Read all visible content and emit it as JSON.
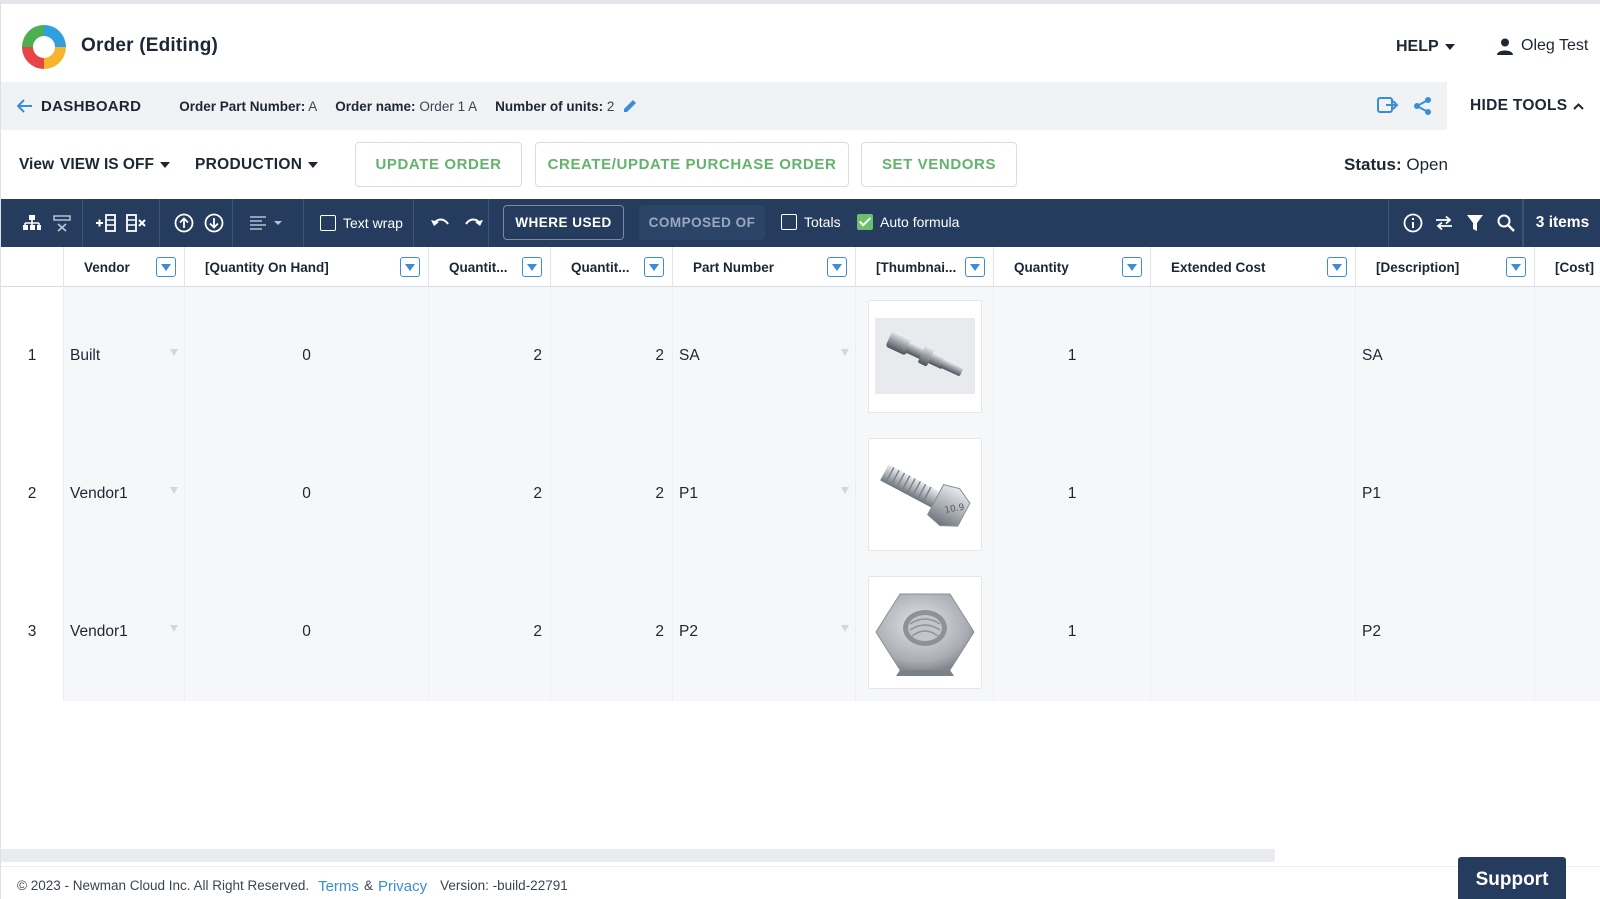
{
  "header": {
    "title": "Order (Editing)",
    "help_label": "HELP",
    "user_name": "Oleg Test"
  },
  "infobar": {
    "back_label": "DASHBOARD",
    "part_number_label": "Order Part Number:",
    "part_number_value": "A",
    "order_name_label": "Order name:",
    "order_name_value": "Order 1 A",
    "units_label": "Number of units:",
    "units_value": "2",
    "hide_tools_label": "HIDE TOOLS"
  },
  "actions": {
    "view_label": "View",
    "view_value": "VIEW IS OFF",
    "production_label": "PRODUCTION",
    "update_order": "UPDATE ORDER",
    "create_po": "CREATE/UPDATE PURCHASE ORDER",
    "set_vendors": "SET VENDORS",
    "status_label": "Status:",
    "status_value": "Open"
  },
  "toolbar": {
    "text_wrap": "Text wrap",
    "where_used": "WHERE USED",
    "composed_of": "COMPOSED OF",
    "totals": "Totals",
    "auto_formula": "Auto formula",
    "text_wrap_checked": false,
    "totals_checked": false,
    "auto_formula_checked": true,
    "items_count": "3 items"
  },
  "table": {
    "columns": [
      "Vendor",
      "[Quantity On Hand]",
      "Quantit...",
      "Quantit...",
      "Part Number",
      "[Thumbnai...",
      "Quantity",
      "Extended Cost",
      "[Description]",
      "[Cost]"
    ],
    "rows": [
      {
        "index": "1",
        "vendor": "Built",
        "qoh": "0",
        "q1": "2",
        "q2": "2",
        "part": "SA",
        "thumb": "shaft-thumbnail",
        "qty": "1",
        "ext_cost": "",
        "desc": "SA",
        "cost": ""
      },
      {
        "index": "2",
        "vendor": "Vendor1",
        "qoh": "0",
        "q1": "2",
        "q2": "2",
        "part": "P1",
        "thumb": "bolt-thumbnail",
        "qty": "1",
        "ext_cost": "",
        "desc": "P1",
        "cost": ""
      },
      {
        "index": "3",
        "vendor": "Vendor1",
        "qoh": "0",
        "q1": "2",
        "q2": "2",
        "part": "P2",
        "thumb": "nut-thumbnail",
        "qty": "1",
        "ext_cost": "",
        "desc": "P2",
        "cost": ""
      }
    ]
  },
  "footer": {
    "copyright": "© 2023 - Newman Cloud Inc. All Right Reserved.",
    "terms": "Terms",
    "amp": "&",
    "privacy": "Privacy",
    "version": "Version: -build-22791",
    "support": "Support"
  },
  "colors": {
    "accent_green": "#62b36b",
    "toolbar_navy": "#253c5e",
    "link_blue": "#3a8ed8"
  }
}
